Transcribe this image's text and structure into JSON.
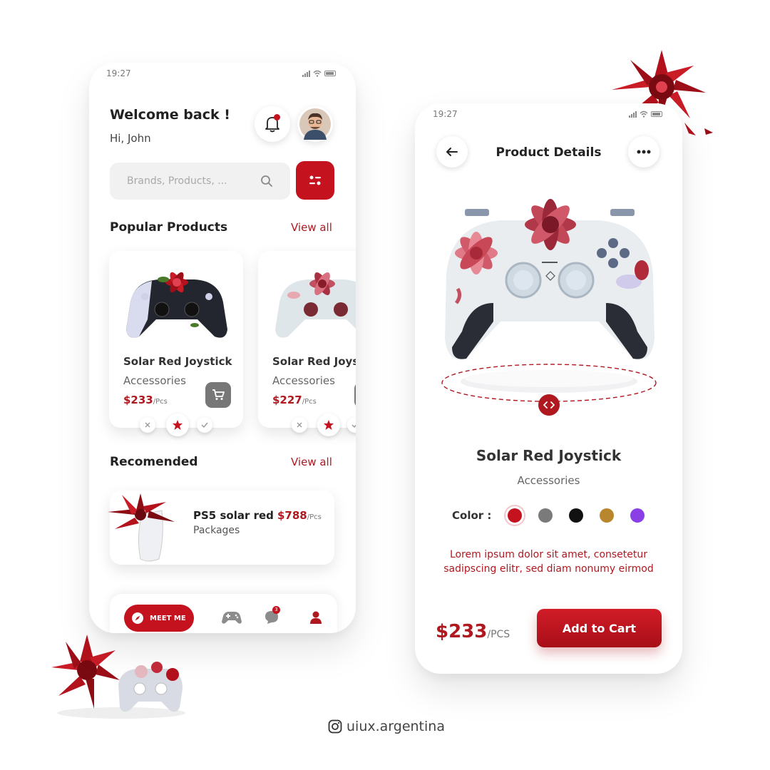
{
  "theme": {
    "accent": "#c4121e",
    "accent_dark": "#b01820"
  },
  "home": {
    "status": {
      "time": "19:27"
    },
    "greeting": "Welcome back !",
    "user_line": "Hi, John",
    "search": {
      "placeholder": "Brands, Products, ...",
      "icon": "search-icon"
    },
    "popular": {
      "title": "Popular Products",
      "view_all": "View all",
      "products": [
        {
          "name": "Solar Red Joystick",
          "category": "Accessories",
          "price": "$233",
          "unit": "/Pcs"
        },
        {
          "name": "Solar Red Joystick",
          "category": "Accessories",
          "price": "$227",
          "unit": "/Pcs"
        }
      ]
    },
    "recommended": {
      "title": "Recomended",
      "view_all": "View all",
      "item": {
        "name": "PS5 solar red",
        "price": "$788",
        "unit": "/Pcs",
        "category": "Packages"
      }
    },
    "nav": {
      "meet_label": "MEET ME",
      "chat_badge": "3"
    }
  },
  "details": {
    "status": {
      "time": "19:27"
    },
    "title": "Product Details",
    "product_name": "Solar Red Joystick",
    "category": "Accessories",
    "color_label": "Color :",
    "colors": [
      "#c4121e",
      "#7a7a7a",
      "#111111",
      "#b8862c",
      "#8a3fe6"
    ],
    "selected_color": 0,
    "description": "Lorem ipsum dolor sit amet, consetetur sadipscing elitr, sed diam nonumy eirmod",
    "price": "$233",
    "unit": "/PCS",
    "add_to_cart": "Add to Cart"
  },
  "footer": {
    "handle": "uiux.argentina",
    "icon": "instagram-icon"
  }
}
